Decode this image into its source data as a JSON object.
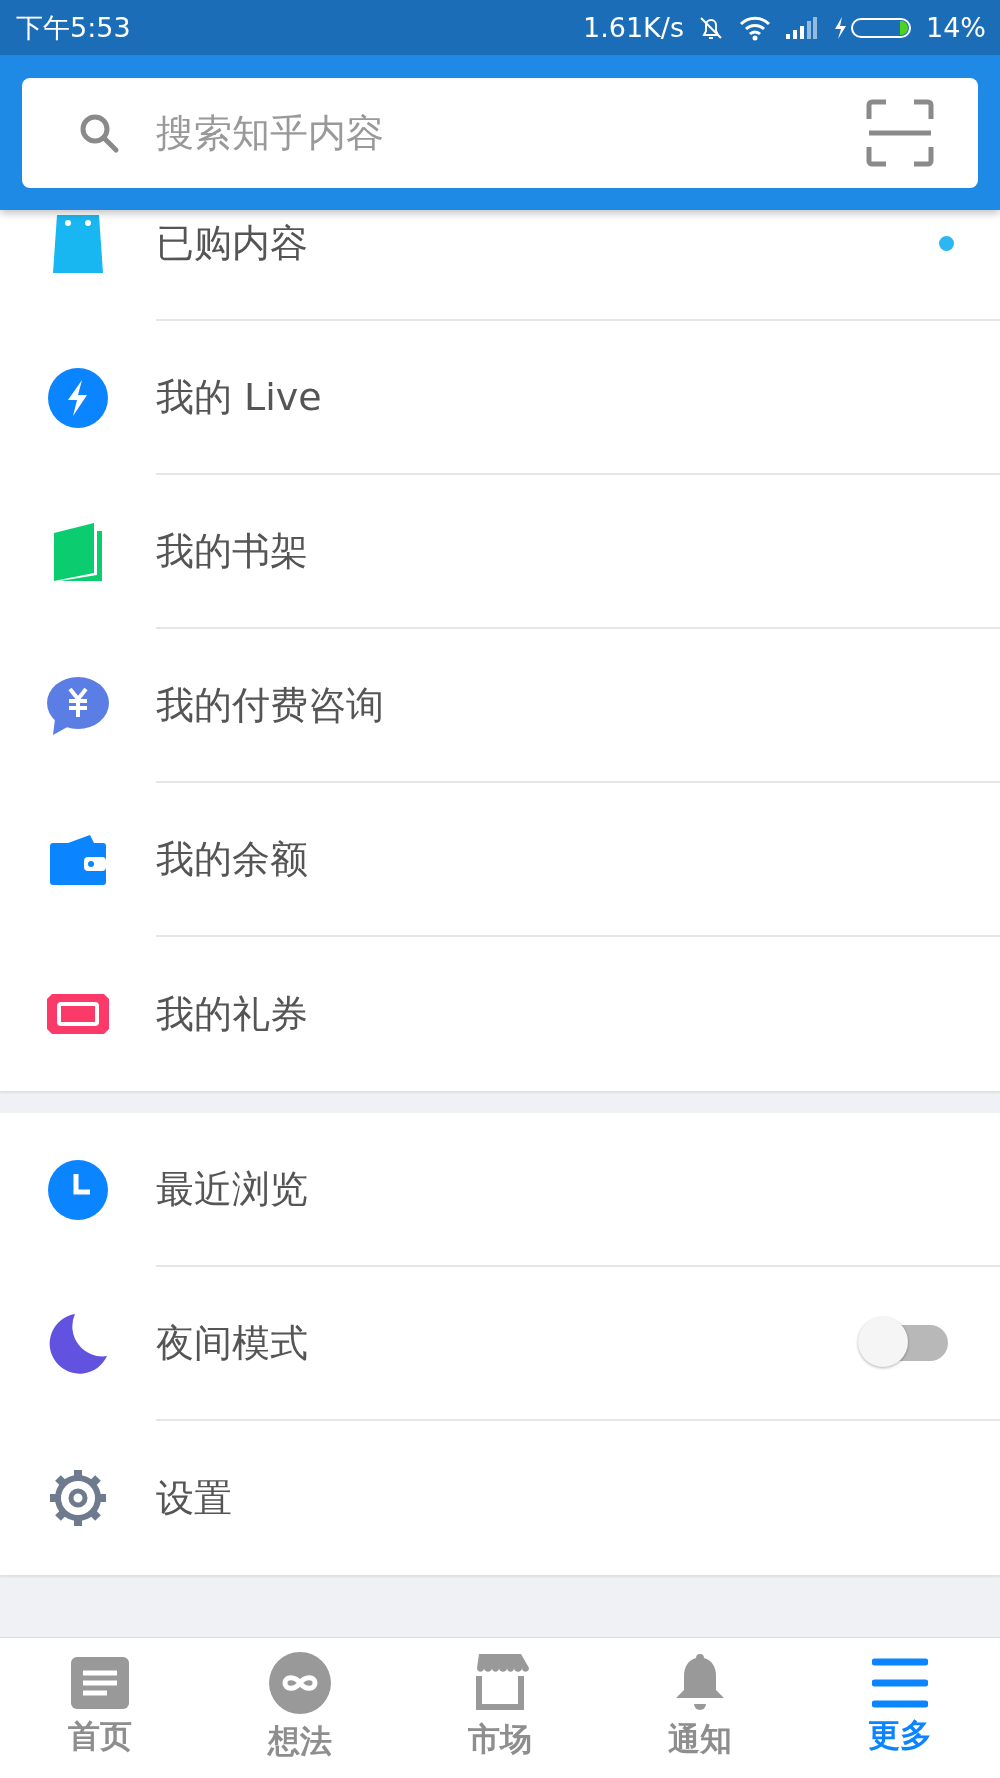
{
  "status_bar": {
    "time": "下午5:53",
    "speed": "1.61K/s",
    "battery": "14%"
  },
  "search": {
    "placeholder": "搜索知乎内容"
  },
  "sections": [
    {
      "items": [
        {
          "label": "已购内容",
          "dot": true,
          "kind": "link"
        },
        {
          "label": "我的 Live",
          "dot": false,
          "kind": "link"
        },
        {
          "label": "我的书架",
          "dot": false,
          "kind": "link"
        },
        {
          "label": "我的付费咨询",
          "dot": false,
          "kind": "link"
        },
        {
          "label": "我的余额",
          "dot": false,
          "kind": "link"
        },
        {
          "label": "我的礼券",
          "dot": false,
          "kind": "link"
        }
      ]
    },
    {
      "items": [
        {
          "label": "最近浏览",
          "dot": false,
          "kind": "link"
        },
        {
          "label": "夜间模式",
          "dot": false,
          "kind": "toggle",
          "on": false
        },
        {
          "label": "设置",
          "dot": false,
          "kind": "link"
        }
      ]
    }
  ],
  "bottom_nav": [
    {
      "label": "首页",
      "selected": false
    },
    {
      "label": "想法",
      "selected": false
    },
    {
      "label": "市场",
      "selected": false
    },
    {
      "label": "通知",
      "selected": false
    },
    {
      "label": "更多",
      "selected": true
    }
  ]
}
